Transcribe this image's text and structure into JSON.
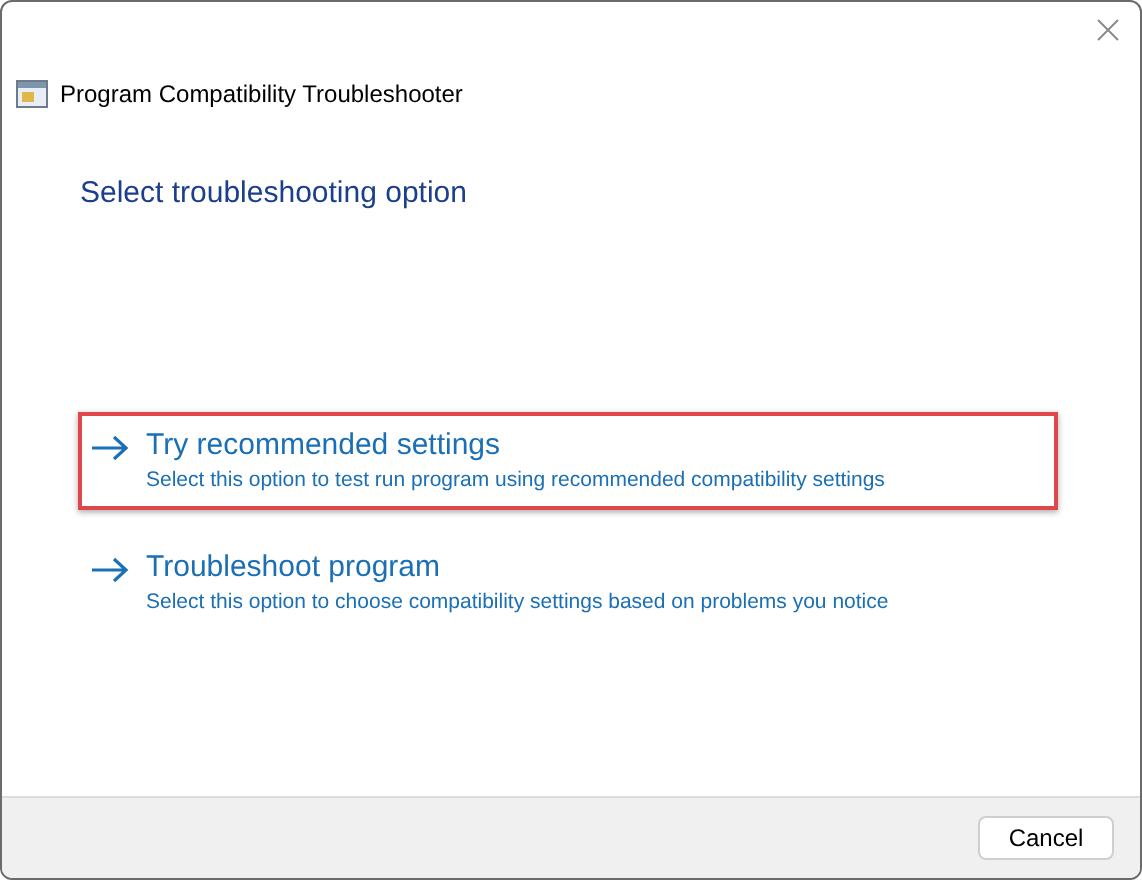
{
  "window": {
    "title": "Program Compatibility Troubleshooter"
  },
  "heading": "Select troubleshooting option",
  "options": [
    {
      "title": "Try recommended settings",
      "description": "Select this option to test run program using recommended compatibility settings",
      "highlighted": true
    },
    {
      "title": "Troubleshoot program",
      "description": "Select this option to choose compatibility settings based on problems you notice",
      "highlighted": false
    }
  ],
  "buttons": [
    "Cancel"
  ]
}
